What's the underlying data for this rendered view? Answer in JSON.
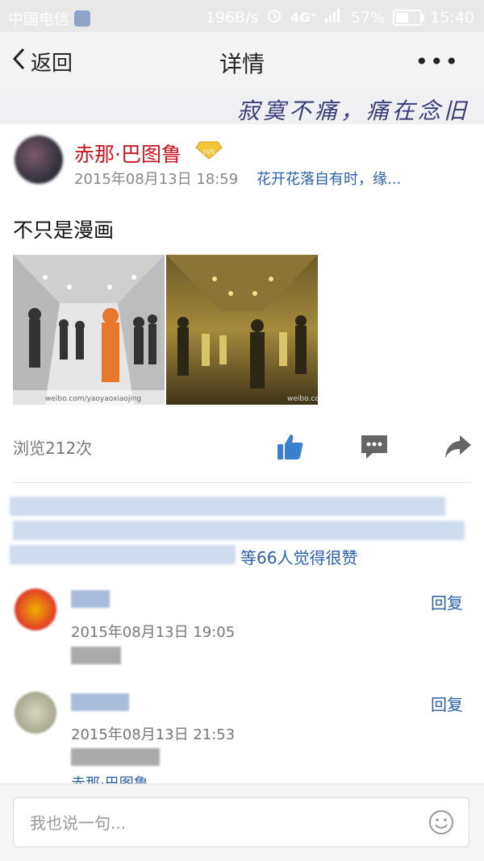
{
  "status_bar": {
    "carrier": "中国电信",
    "net_speed": "196B/s",
    "signal": "4G⁺",
    "battery": "57%",
    "battery_level": 0.57,
    "time": "15:40"
  },
  "nav": {
    "back_label": "返回",
    "title": "详情",
    "more_label": "•••"
  },
  "banner": {
    "text": "寂寞不痛，痛在念旧"
  },
  "post": {
    "username": "赤那·巴图鲁",
    "vip_level": "LV5",
    "timestamp": "2015年08月13日 18:59",
    "signature": "花开花落自有时，缘...",
    "text": "不只是漫画",
    "image1_watermark": "weibo.com/yaoyaoxiaojing",
    "image2_watermark": "weibo.com",
    "views": "浏览212次",
    "colors": {
      "username": "#c8161e",
      "link": "#2b5fa8",
      "accent_icon": "#3a7fd0"
    }
  },
  "likes": {
    "summary": "等66人觉得很赞"
  },
  "comments": [
    {
      "time": "2015年08月13日 19:05",
      "reply_label": "回复"
    },
    {
      "time": "2015年08月13日 21:53",
      "reply_label": "回复"
    }
  ],
  "comment_partial": "赤那·巴图鲁",
  "input": {
    "placeholder": "我也说一句..."
  }
}
